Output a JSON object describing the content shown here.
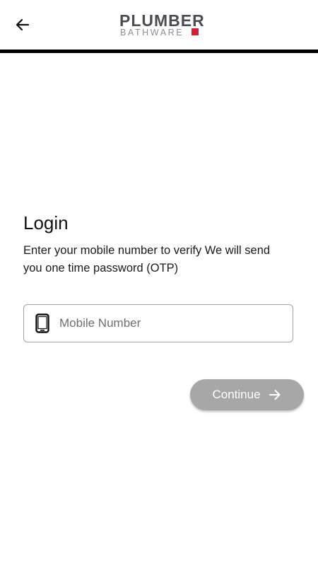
{
  "header": {
    "back_icon": "arrow-left-icon",
    "logo": {
      "top_text": "PLUMBER",
      "bottom_text": "BATHWARE",
      "text_color": "#4a4d52",
      "accent_color": "#d11f2f"
    },
    "rule_color": "#000000"
  },
  "login": {
    "title": "Login",
    "description": "Enter your mobile number to verify We will send you one time password (OTP)",
    "mobile_field": {
      "icon": "smartphone-icon",
      "placeholder": "Mobile Number",
      "value": ""
    },
    "continue_button": {
      "label": "Continue",
      "icon": "arrow-right-icon",
      "background_color": "#a7a7a7"
    }
  }
}
